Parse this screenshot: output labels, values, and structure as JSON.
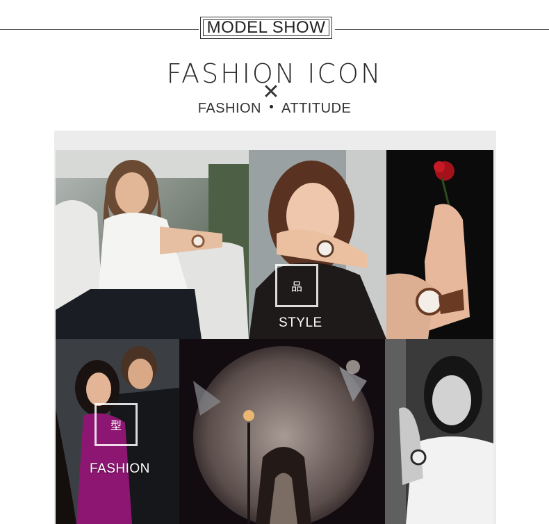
{
  "header": {
    "badge": "MODEL SHOW",
    "headline": "FASHION ICON",
    "times_symbol": "✕",
    "tagline_left": "FASHION",
    "tagline_right": "ATTITUDE"
  },
  "gallery": {
    "style_char": "品",
    "style_label": "STYLE",
    "fashion_char": "型",
    "fashion_label": "FASHION"
  }
}
